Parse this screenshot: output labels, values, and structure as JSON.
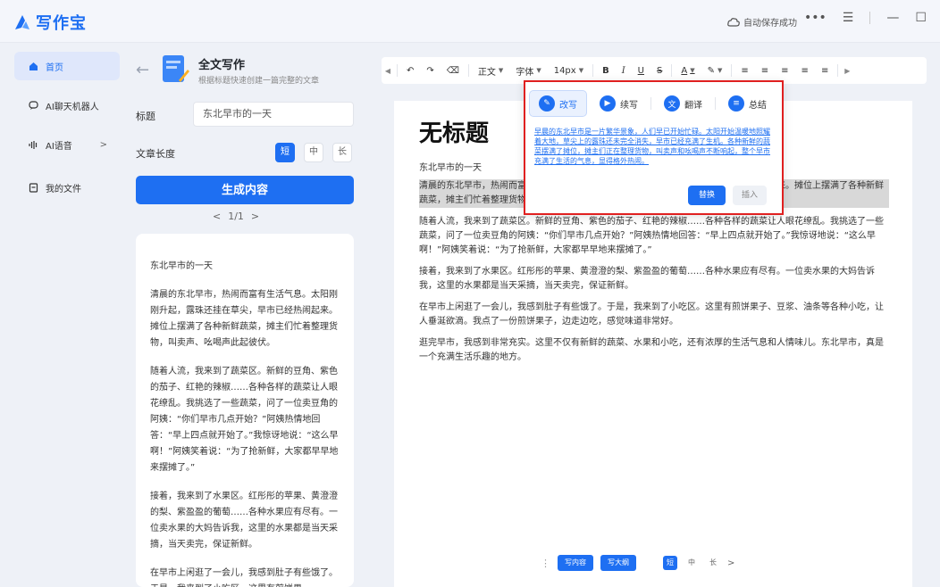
{
  "app": {
    "logo_text": "写作宝",
    "autosave": "自动保存成功",
    "more": "•••",
    "menu": "☰",
    "minimize": "—",
    "maximize": "☐",
    "close": "✕"
  },
  "nav": {
    "items": [
      {
        "label": "首页"
      },
      {
        "label": "AI聊天机器人"
      },
      {
        "label": "AI语音",
        "chevron": ">"
      },
      {
        "label": "我的文件"
      }
    ]
  },
  "panel": {
    "back": "←",
    "title": "全文写作",
    "subtitle": "根据标题快速创建一篇完整的文章",
    "title_label": "标题",
    "title_value": "东北早市的一天",
    "length_label": "文章长度",
    "lengths": [
      "短",
      "中",
      "长"
    ],
    "generate": "生成内容",
    "pager_prev": "<",
    "pager_text": "1/1",
    "pager_next": ">"
  },
  "result": {
    "paragraphs": [
      "东北早市的一天",
      "清晨的东北早市，热闹而富有生活气息。太阳刚刚升起，露珠还挂在草尖，早市已经热闹起来。摊位上摆满了各种新鲜蔬菜，摊主们忙着整理货物，叫卖声、吆喝声此起彼伏。",
      "随着人流，我来到了蔬菜区。新鲜的豆角、紫色的茄子、红艳的辣椒……各种各样的蔬菜让人眼花缭乱。我挑选了一些蔬菜，问了一位卖豆角的阿姨：“你们早市几点开始？”阿姨热情地回答：“早上四点就开始了。”我惊讶地说：“这么早啊！”阿姨笑着说：“为了抢新鲜，大家都早早地来摆摊了。”",
      "接着，我来到了水果区。红彤彤的苹果、黄澄澄的梨、紫盈盈的葡萄……各种水果应有尽有。一位卖水果的大妈告诉我，这里的水果都是当天采摘，当天卖完，保证新鲜。",
      "在早市上闲逛了一会儿，我感到肚子有些饿了。于是，我来到了小吃区。这里有煎饼果"
    ]
  },
  "toolbar": {
    "undo": "↶",
    "redo": "↷",
    "clear": "⌫",
    "paragraph": "正文",
    "font": "字体",
    "size": "14px",
    "bold": "B",
    "italic": "I",
    "underline": "U",
    "strike": "S",
    "font_color": "A",
    "highlight": "✎",
    "align1": "≡",
    "align2": "≡",
    "align3": "≡",
    "align4": "≡",
    "align5": "≡"
  },
  "doc": {
    "title": "无标题",
    "subtitle": "东北早市的一天",
    "paragraphs": [
      "清晨的东北早市，热闹而富有生活气息。太阳刚刚升起，露珠还挂在草尖，早市已经热闹起来。摊位上摆满了各种新鲜蔬菜，摊主们忙着整理货物，叫卖声、吆喝声此起彼伏。",
      "随着人流，我来到了蔬菜区。新鲜的豆角、紫色的茄子、红艳的辣椒……各种各样的蔬菜让人眼花缭乱。我挑选了一些蔬菜，问了一位卖豆角的阿姨：“你们早市几点开始？”阿姨热情地回答：“早上四点就开始了。”我惊讶地说：“这么早啊！”阿姨笑着说：“为了抢新鲜，大家都早早地来摆摊了。”",
      "接着，我来到了水果区。红彤彤的苹果、黄澄澄的梨、紫盈盈的葡萄……各种水果应有尽有。一位卖水果的大妈告诉我，这里的水果都是当天采摘，当天卖完，保证新鲜。",
      "在早市上闲逛了一会儿，我感到肚子有些饿了。于是，我来到了小吃区。这里有煎饼果子、豆浆、油条等各种小吃，让人垂涎欲滴。我点了一份煎饼果子，边走边吃，感觉味道非常好。",
      "逛完早市，我感到非常充实。这里不仅有新鲜的蔬菜、水果和小吃，还有浓厚的生活气息和人情味儿。东北早市，真是一个充满生活乐趣的地方。"
    ]
  },
  "popup": {
    "tabs": [
      {
        "label": "改写",
        "icon": "✎"
      },
      {
        "label": "续写",
        "icon": "▶"
      },
      {
        "label": "翻译",
        "icon": "文"
      },
      {
        "label": "总结",
        "icon": "≡"
      }
    ],
    "text": "早晨的东北早市是一片繁华景象，人们早已开始忙碌。太阳开始温暖地照耀着大地，草尖上的露珠还未完全消失，早市已经充满了生机。各种新鲜的蔬菜摆满了摊位，摊主们正在整理货物，叫卖声和吆喝声不断响起，整个早市充满了生活的气息，显得格外热闹。",
    "replace": "替换",
    "insert": "插入"
  },
  "bottom_bar": {
    "handle": "⋮",
    "write_content": "写内容",
    "write_outline": "写大纲",
    "lengths": [
      "短",
      "中",
      "长"
    ],
    "next": ">"
  },
  "colors": {
    "accent": "#1e6ff2",
    "highlight_border": "#e02020"
  }
}
